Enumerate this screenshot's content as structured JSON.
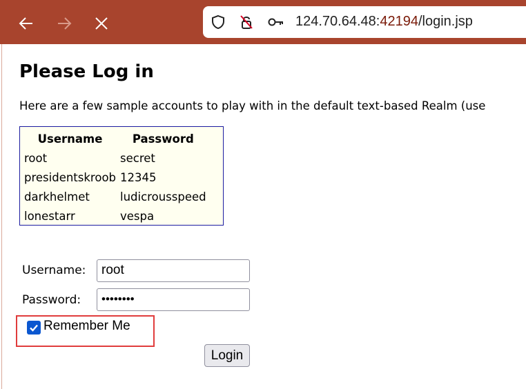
{
  "browser": {
    "back_icon": "back-arrow-icon",
    "forward_icon": "forward-arrow-icon",
    "stop_icon": "close-icon",
    "url_host": "124.70.64.48:",
    "url_port": "42194",
    "url_path": "/login.jsp"
  },
  "page": {
    "title": "Please Log in",
    "intro": "Here are a few sample accounts to play with in the default text-based Realm (use"
  },
  "accounts": {
    "headers": [
      "Username",
      "Password"
    ],
    "rows": [
      [
        "root",
        "secret"
      ],
      [
        "presidentskroob",
        "12345"
      ],
      [
        "darkhelmet",
        "ludicrousspeed"
      ],
      [
        "lonestarr",
        "vespa"
      ]
    ]
  },
  "form": {
    "username_label": "Username:",
    "username_value": "root",
    "password_label": "Password:",
    "password_value": "••••••••",
    "remember_label": "Remember Me",
    "remember_checked": true,
    "login_label": "Login"
  },
  "colors": {
    "toolbar": "#a8442d",
    "checkbox": "#0b57d0",
    "highlight": "#e03c3c",
    "table_bg": "#fffff0"
  }
}
